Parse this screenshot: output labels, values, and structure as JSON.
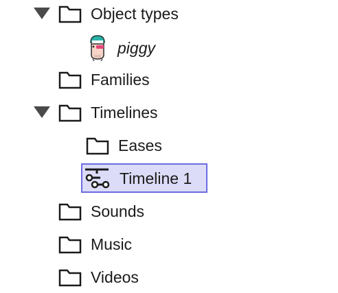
{
  "tree": {
    "object_types": {
      "label": "Object types",
      "expanded": true,
      "children": [
        {
          "label": "piggy",
          "icon": "sprite-icon"
        }
      ]
    },
    "families": {
      "label": "Families"
    },
    "timelines": {
      "label": "Timelines",
      "expanded": true,
      "children": [
        {
          "label": "Eases",
          "icon": "folder-icon"
        },
        {
          "label": "Timeline 1",
          "icon": "timeline-icon",
          "selected": true
        }
      ]
    },
    "sounds": {
      "label": "Sounds"
    },
    "music": {
      "label": "Music"
    },
    "videos": {
      "label": "Videos"
    }
  },
  "colors": {
    "selection_bg": "#dcdcf8",
    "selection_border": "#6b6be0",
    "twisty": "#4a4a4a",
    "icon_stroke": "#1a1a1a"
  }
}
